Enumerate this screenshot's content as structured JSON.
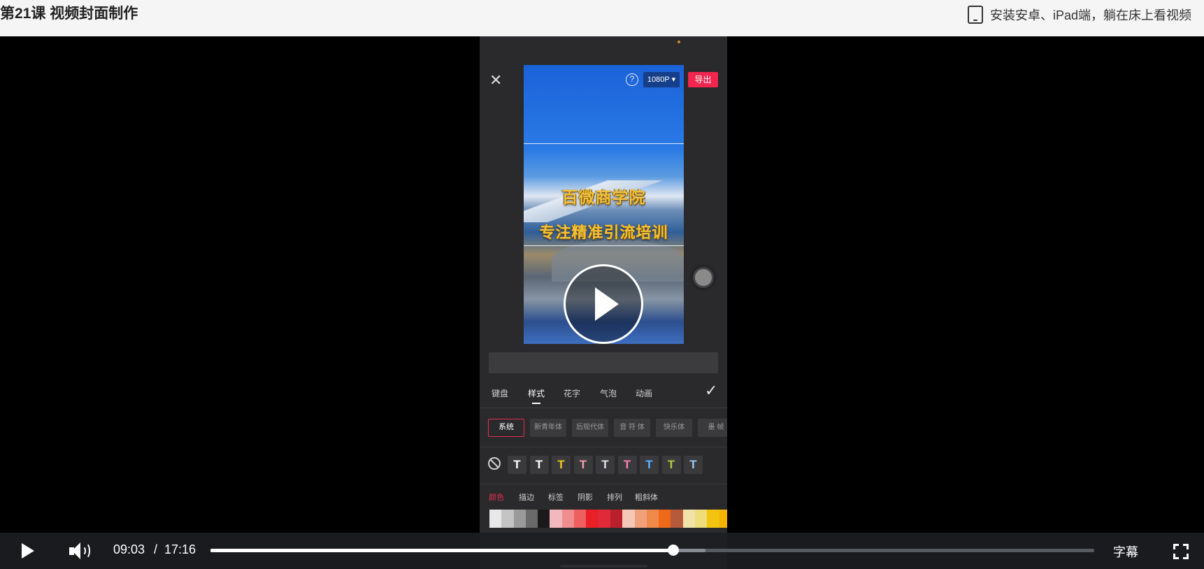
{
  "header": {
    "lesson_title": "第21课 视频封面制作",
    "install_tip": "安装安卓、iPad端，躺在床上看视频"
  },
  "phone": {
    "editor": {
      "resolution": "1080P ▾",
      "export_label": "导出",
      "help_symbol": "?",
      "close_symbol": "✕",
      "confirm_symbol": "✓"
    },
    "cover_text": {
      "line1": "百微商学院",
      "line2": "专注精准引流培训"
    },
    "tabs": [
      "键盘",
      "样式",
      "花字",
      "气泡",
      "动画"
    ],
    "active_tab": "样式",
    "fonts": [
      "系统",
      "新青年体",
      "后现代体",
      "音 符 体",
      "快乐体",
      "墨 帧"
    ],
    "active_font": "系统",
    "text_styles": [
      {
        "glyph": "T",
        "color": "#ffffff"
      },
      {
        "glyph": "T",
        "color": "#ffffff"
      },
      {
        "glyph": "T",
        "color": "#f3c623"
      },
      {
        "glyph": "T",
        "color": "#f5a0a8"
      },
      {
        "glyph": "T",
        "color": "#dfe3ea"
      },
      {
        "glyph": "T",
        "color": "#ff7fb0"
      },
      {
        "glyph": "T",
        "color": "#58b3ff"
      },
      {
        "glyph": "T",
        "color": "#b7c93a"
      },
      {
        "glyph": "T",
        "color": "#9fc7ee"
      }
    ],
    "style_subtabs": [
      "颜色",
      "描边",
      "标签",
      "阴影",
      "排列",
      "粗斜体"
    ],
    "active_subtab": "颜色",
    "palette": [
      "#e8e8e8",
      "#c4c4c4",
      "#9a9a9a",
      "#6a6a6a",
      "#1a1a1a",
      "#f2b8c0",
      "#ee8e8e",
      "#ee6060",
      "#ea2027",
      "#e02a3a",
      "#b8202c",
      "#f5c7b8",
      "#f0a07a",
      "#f08a4b",
      "#ee6a1a",
      "#b55a3a",
      "#f1e3a8",
      "#efdc7a",
      "#f2c40f",
      "#f5b300"
    ]
  },
  "player": {
    "current_time": "09:03",
    "separator": "/",
    "duration": "17:16",
    "played_fraction": 0.524,
    "buffered_fraction": 0.56,
    "subtitle_label": "字幕"
  }
}
